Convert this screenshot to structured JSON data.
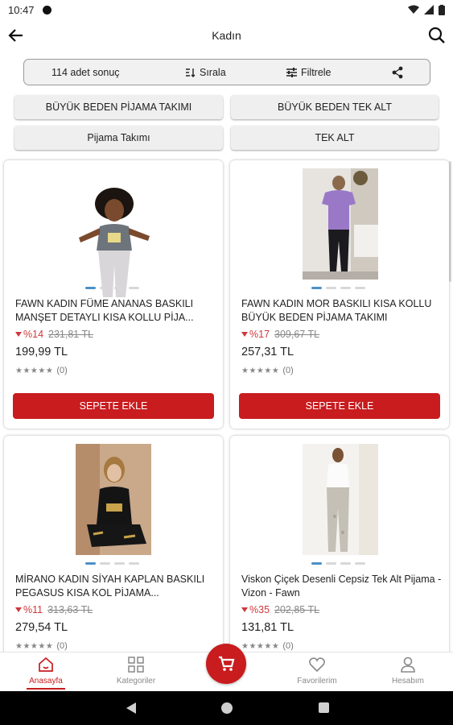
{
  "status_bar": {
    "time": "10:47"
  },
  "header": {
    "title": "Kadın"
  },
  "toolbar": {
    "result_count": "114 adet sonuç",
    "sort_label": "Sırala",
    "filter_label": "Filtrele"
  },
  "chips": [
    "BÜYÜK BEDEN PİJAMA TAKIMI",
    "BÜYÜK BEDEN TEK ALT",
    "Pijama Takımı",
    "TEK ALT"
  ],
  "products": [
    {
      "name": "FAWN KADIN FÜME ANANAS BASKILI MANŞET DETAYLI KISA KOLLU PİJA...",
      "discount": "%14",
      "old_price": "231,81 TL",
      "price": "199,99 TL",
      "rating_count": "(0)",
      "button": "SEPETE EKLE"
    },
    {
      "name": "FAWN KADIN MOR BASKILI KISA KOLLU BÜYÜK BEDEN PİJAMA TAKIMI",
      "discount": "%17",
      "old_price": "309,67 TL",
      "price": "257,31 TL",
      "rating_count": "(0)",
      "button": "SEPETE EKLE"
    },
    {
      "name": "MİRANO KADIN SİYAH KAPLAN BASKILI PEGASUS KISA KOL PİJAMA...",
      "discount": "%11",
      "old_price": "313,63 TL",
      "price": "279,54 TL",
      "rating_count": "(0)"
    },
    {
      "name": "Viskon Çiçek Desenli Cepsiz Tek Alt Pijama - Vizon - Fawn",
      "discount": "%35",
      "old_price": "202,85 TL",
      "price": "131,81 TL",
      "rating_count": "(0)"
    }
  ],
  "bottom_nav": {
    "home": "Anasayfa",
    "categories": "Kategoriler",
    "favorites": "Favorilerim",
    "account": "Hesabım"
  },
  "colors": {
    "accent": "#c81c1f",
    "discount": "#d0373b",
    "dot_active": "#4a90c8"
  }
}
